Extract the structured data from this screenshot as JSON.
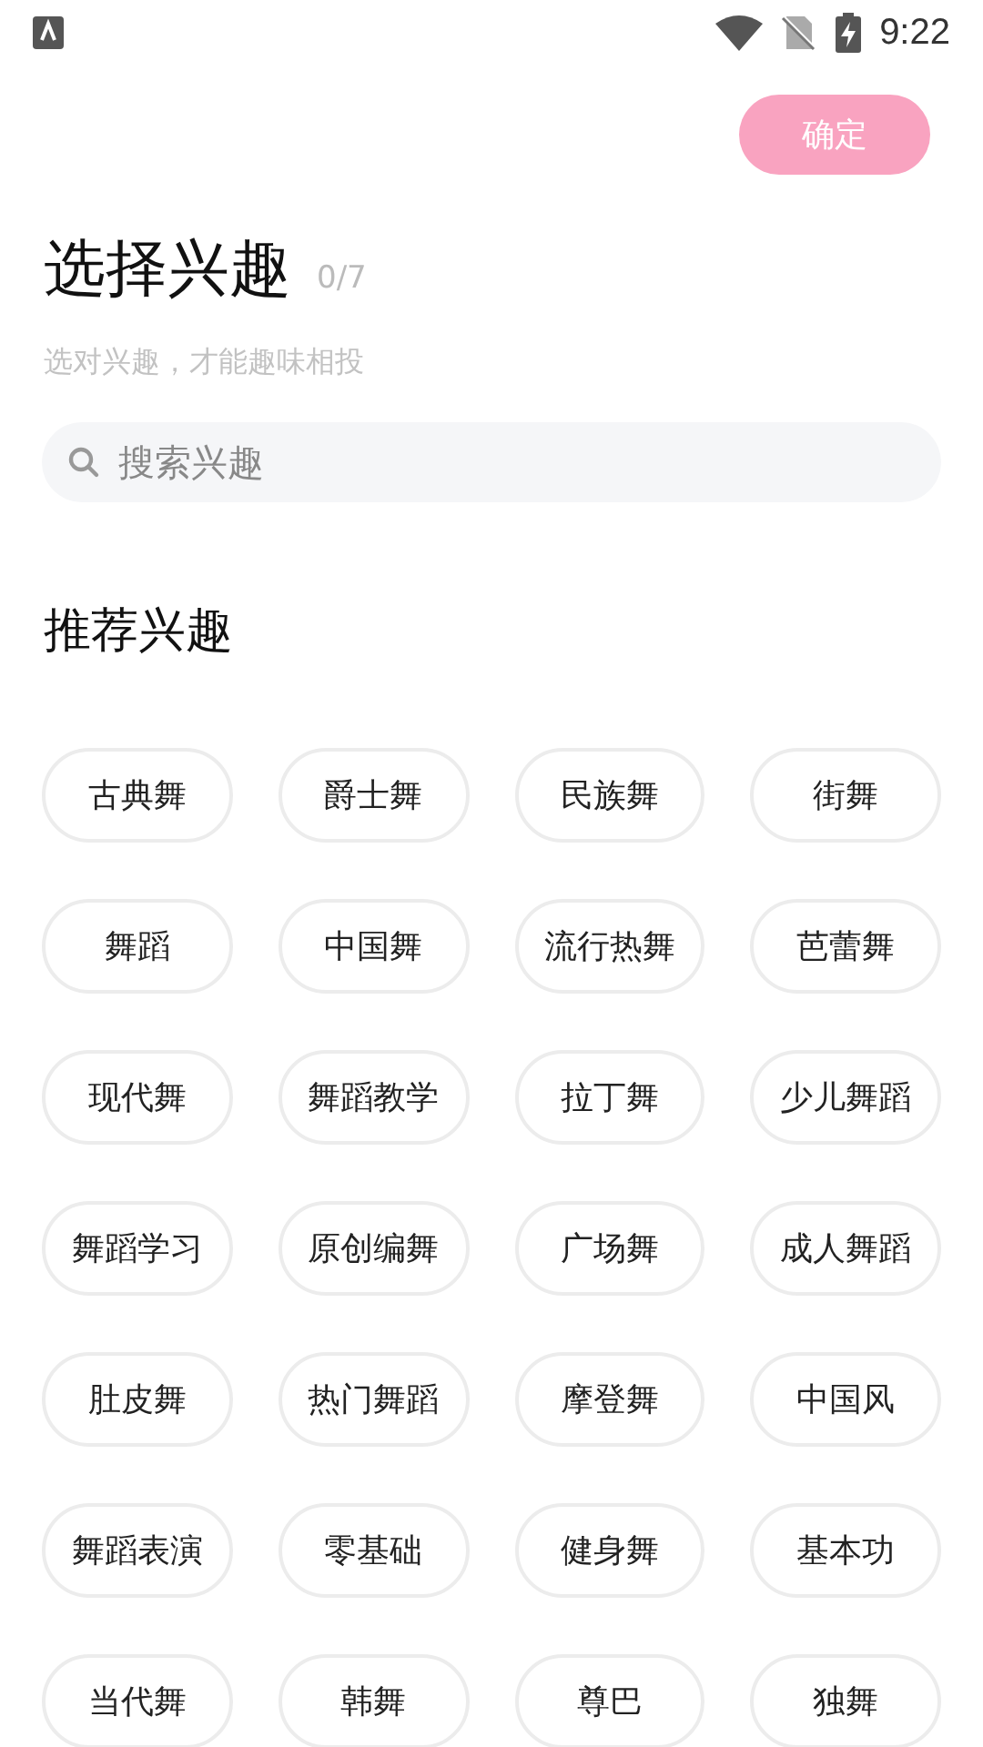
{
  "status_bar": {
    "time": "9:22"
  },
  "confirm_button": {
    "label": "确定",
    "disabled": true
  },
  "header": {
    "title": "选择兴趣",
    "count": "0/7",
    "subtitle": "选对兴趣，才能趣味相投"
  },
  "search": {
    "placeholder": "搜索兴趣"
  },
  "section_title": "推荐兴趣",
  "tags": [
    {
      "label": "古典舞",
      "selected": false
    },
    {
      "label": "爵士舞",
      "selected": false
    },
    {
      "label": "民族舞",
      "selected": false
    },
    {
      "label": "街舞",
      "selected": false
    },
    {
      "label": "舞蹈",
      "selected": false
    },
    {
      "label": "中国舞",
      "selected": false
    },
    {
      "label": "流行热舞",
      "selected": false
    },
    {
      "label": "芭蕾舞",
      "selected": false
    },
    {
      "label": "现代舞",
      "selected": false
    },
    {
      "label": "舞蹈教学",
      "selected": false
    },
    {
      "label": "拉丁舞",
      "selected": false
    },
    {
      "label": "少儿舞蹈",
      "selected": false
    },
    {
      "label": "舞蹈学习",
      "selected": false
    },
    {
      "label": "原创编舞",
      "selected": false
    },
    {
      "label": "广场舞",
      "selected": false
    },
    {
      "label": "成人舞蹈",
      "selected": false
    },
    {
      "label": "肚皮舞",
      "selected": false
    },
    {
      "label": "热门舞蹈",
      "selected": false
    },
    {
      "label": "摩登舞",
      "selected": false
    },
    {
      "label": "中国风",
      "selected": false
    },
    {
      "label": "舞蹈表演",
      "selected": false
    },
    {
      "label": "零基础",
      "selected": false
    },
    {
      "label": "健身舞",
      "selected": false
    },
    {
      "label": "基本功",
      "selected": false
    },
    {
      "label": "当代舞",
      "selected": false
    },
    {
      "label": "韩舞",
      "selected": false
    },
    {
      "label": "尊巴",
      "selected": false
    },
    {
      "label": "独舞",
      "selected": false
    }
  ]
}
